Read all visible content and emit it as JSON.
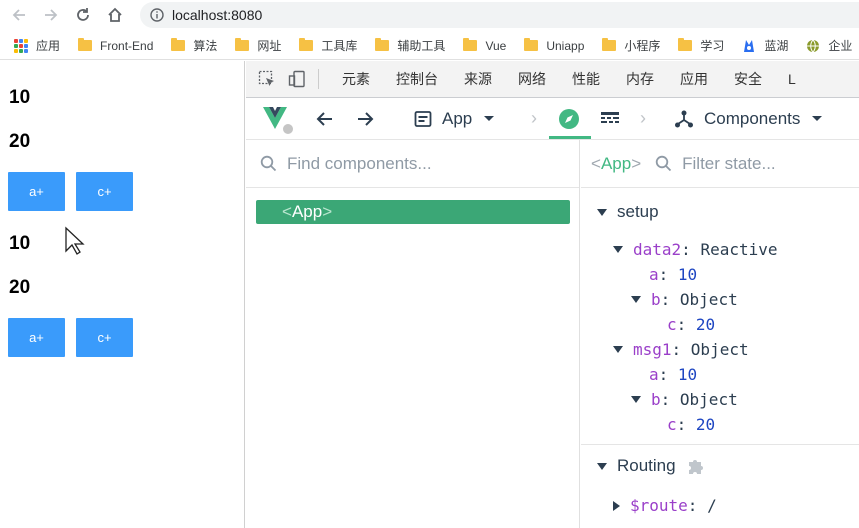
{
  "browser": {
    "url": "localhost:8080",
    "bookmarks": [
      {
        "label": "应用",
        "kind": "apps"
      },
      {
        "label": "Front-End",
        "kind": "folder"
      },
      {
        "label": "算法",
        "kind": "folder"
      },
      {
        "label": "网址",
        "kind": "folder"
      },
      {
        "label": "工具库",
        "kind": "folder"
      },
      {
        "label": "辅助工具",
        "kind": "folder"
      },
      {
        "label": "Vue",
        "kind": "folder"
      },
      {
        "label": "Uniapp",
        "kind": "folder"
      },
      {
        "label": "小程序",
        "kind": "folder"
      },
      {
        "label": "学习",
        "kind": "folder"
      },
      {
        "label": "蓝湖",
        "kind": "site"
      },
      {
        "label": "企业",
        "kind": "site"
      }
    ]
  },
  "app": {
    "block1": {
      "value_a": "10",
      "value_b": "20",
      "btn_a": "a+",
      "btn_c": "c+"
    },
    "block2": {
      "value_a": "10",
      "value_b": "20",
      "btn_a": "a+",
      "btn_c": "c+"
    }
  },
  "devtools": {
    "tabs": [
      "元素",
      "控制台",
      "来源",
      "网络",
      "性能",
      "内存",
      "应用",
      "安全",
      "L"
    ],
    "vue_toolbar": {
      "app_selector": "App",
      "components_label": "Components"
    },
    "components_search_placeholder": "Find components...",
    "selected_component": {
      "open": "<",
      "name": "App",
      "close": ">"
    },
    "state_search_placeholder": "Filter state...",
    "state": {
      "setup_label": "setup",
      "data2": {
        "key": "data2",
        "type": "Reactive",
        "a": {
          "key": "a",
          "value": "10"
        },
        "b": {
          "key": "b",
          "type": "Object",
          "c": {
            "key": "c",
            "value": "20"
          }
        }
      },
      "msg1": {
        "key": "msg1",
        "type": "Object",
        "a": {
          "key": "a",
          "value": "10"
        },
        "b": {
          "key": "b",
          "type": "Object",
          "c": {
            "key": "c",
            "value": "20"
          }
        }
      },
      "routing_label": "Routing",
      "route_key": "$route",
      "route_value": "/"
    }
  },
  "colors": {
    "vue_green": "#42b883",
    "button_blue": "#3a9bfb",
    "selected_row": "#3ba776"
  }
}
